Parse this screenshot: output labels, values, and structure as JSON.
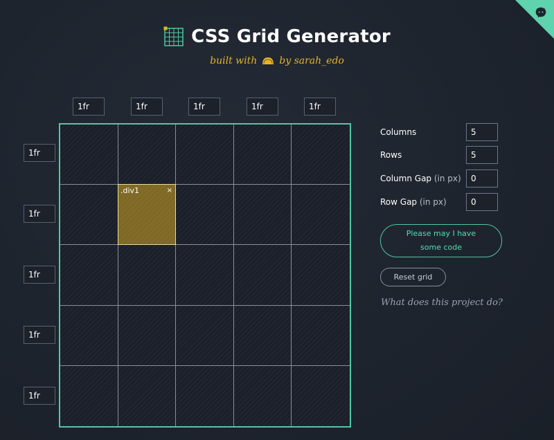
{
  "header": {
    "title": "CSS Grid Generator",
    "subtitle_prefix": "built with",
    "subtitle_suffix": "by sarah_edo",
    "title_icon": "grid-icon",
    "subtitle_icon": "taco-icon"
  },
  "corner": {
    "icon": "github-octocat-icon",
    "color": "#5ed3ad"
  },
  "columns": [
    "1fr",
    "1fr",
    "1fr",
    "1fr",
    "1fr"
  ],
  "rows": [
    "1fr",
    "1fr",
    "1fr",
    "1fr",
    "1fr"
  ],
  "grid_item": {
    "label": ".div1",
    "close_label": "×",
    "color": "#826c27"
  },
  "controls": {
    "columns_label": "Columns",
    "columns_value": "5",
    "rows_label": "Rows",
    "rows_value": "5",
    "column_gap_label": "Column Gap",
    "column_gap_unit": "(in px)",
    "column_gap_value": "0",
    "row_gap_label": "Row Gap",
    "row_gap_unit": "(in px)",
    "row_gap_value": "0"
  },
  "buttons": {
    "code_label": "Please may I have some code",
    "reset_label": "Reset grid"
  },
  "about_link": "What does this project do?",
  "colors": {
    "accent": "#4fc9a3",
    "highlight": "#e5b32a",
    "background": "#1e242e"
  }
}
